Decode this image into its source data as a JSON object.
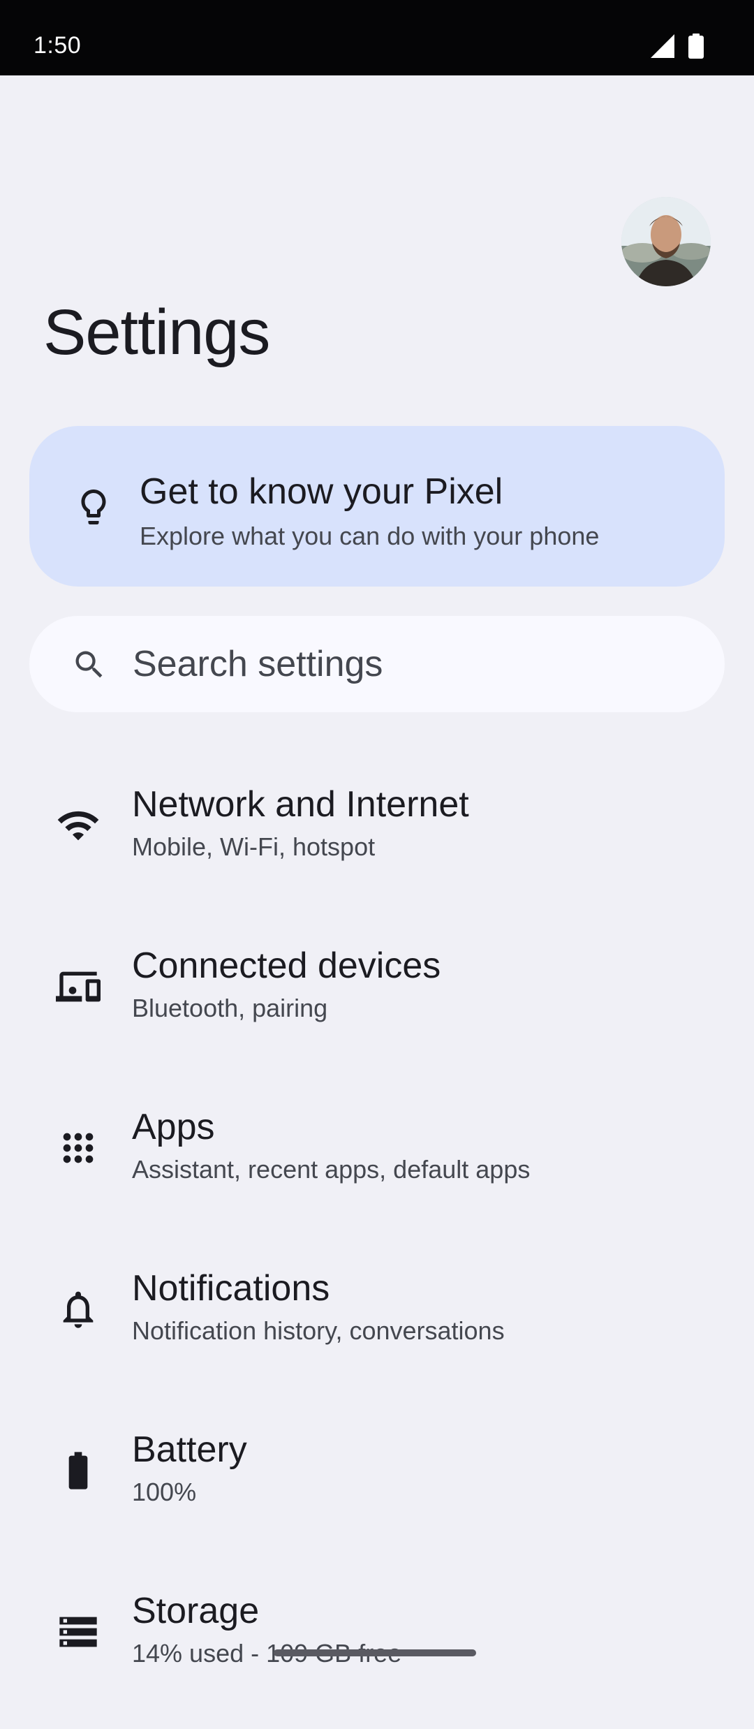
{
  "status_bar": {
    "time": "1:50",
    "icons": [
      "cell-signal-icon",
      "battery-icon"
    ]
  },
  "header": {
    "title": "Settings",
    "avatar": "account-avatar"
  },
  "pixel_card": {
    "title": "Get to know your Pixel",
    "subtitle": "Explore what you can do with your phone",
    "icon": "lightbulb-icon",
    "background": "#d8e2fc"
  },
  "search": {
    "placeholder": "Search settings",
    "icon": "search-icon"
  },
  "items": [
    {
      "title": "Network and Internet",
      "subtitle": "Mobile, Wi-Fi, hotspot",
      "icon": "wifi-icon"
    },
    {
      "title": "Connected devices",
      "subtitle": "Bluetooth, pairing",
      "icon": "devices-icon"
    },
    {
      "title": "Apps",
      "subtitle": "Assistant, recent apps, default apps",
      "icon": "apps-grid-icon"
    },
    {
      "title": "Notifications",
      "subtitle": "Notification history, conversations",
      "icon": "bell-icon"
    },
    {
      "title": "Battery",
      "subtitle": "100%",
      "icon": "battery-icon"
    },
    {
      "title": "Storage",
      "subtitle": "14% used - 109 GB free",
      "icon": "storage-icon"
    }
  ],
  "colors": {
    "background": "#f0f0f6",
    "status_bar": "#050506",
    "card": "#d8e2fc",
    "search_bg": "#f9f9ff",
    "text_primary": "#1b1b21",
    "text_secondary": "#44474f"
  }
}
